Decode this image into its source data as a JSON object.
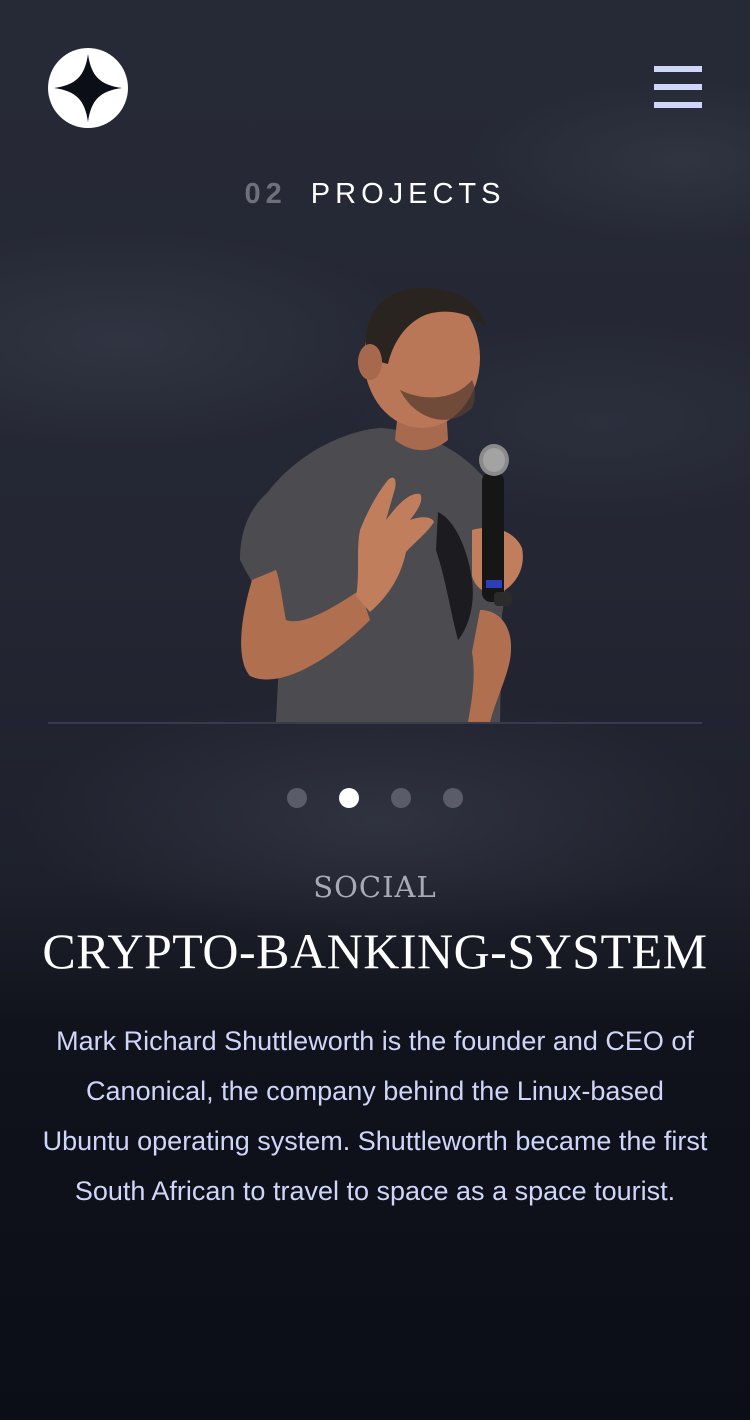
{
  "header": {
    "logo": {
      "icon": "four-point-star-icon",
      "background": "#ffffff",
      "star_color": "#0b0d17"
    },
    "menu": {
      "icon": "hamburger-menu-icon",
      "color": "#d0d6f9"
    }
  },
  "page_heading": {
    "number": "02",
    "label": "PROJECTS"
  },
  "carousel": {
    "slide_count": 4,
    "active_index": 1,
    "dots": [
      {
        "active": false
      },
      {
        "active": true
      },
      {
        "active": false
      },
      {
        "active": false
      }
    ]
  },
  "member": {
    "role": "SOCIAL",
    "name": "CRYPTO-BANKING-SYSTEM",
    "bio": "Mark Richard Shuttleworth is the founder and CEO of Canonical, the company behind the Linux-based Ubuntu operating system. Shuttleworth became the first South African to travel to space as a space tourist."
  },
  "colors": {
    "background": "#0b0d17",
    "accent_light": "#d0d6f9",
    "heading_number": "#6f717a",
    "role_text": "#a8aab4",
    "divider": "#383b4b"
  }
}
